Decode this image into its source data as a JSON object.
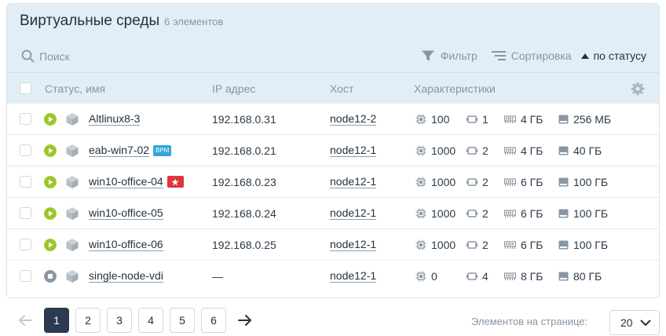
{
  "header": {
    "title": "Виртуальные среды",
    "count": "6 элементов"
  },
  "toolbar": {
    "search_placeholder": "Поиск",
    "filter_label": "Фильтр",
    "sort_label": "Сортировка",
    "sort_by": "по статусу"
  },
  "table": {
    "columns": {
      "status_name": "Статус, имя",
      "ip": "IP адрес",
      "host": "Хост",
      "specs": "Характеристики"
    },
    "rows": [
      {
        "name": "Altlinux8-3",
        "status": "running",
        "badge": "",
        "ip": "192.168.0.31",
        "host": "node12-2",
        "cpu": "100",
        "cores": "1",
        "ram": "4 ГБ",
        "disk": "256 МБ"
      },
      {
        "name": "eab-win7-02",
        "status": "running",
        "badge": "ВРМ",
        "ip": "192.168.0.21",
        "host": "node12-1",
        "cpu": "1000",
        "cores": "2",
        "ram": "4 ГБ",
        "disk": "40 ГБ"
      },
      {
        "name": "win10-office-04",
        "status": "running",
        "badge": "star",
        "ip": "192.168.0.23",
        "host": "node12-1",
        "cpu": "1000",
        "cores": "2",
        "ram": "6 ГБ",
        "disk": "100 ГБ"
      },
      {
        "name": "win10-office-05",
        "status": "running",
        "badge": "",
        "ip": "192.168.0.24",
        "host": "node12-1",
        "cpu": "1000",
        "cores": "2",
        "ram": "6 ГБ",
        "disk": "100 ГБ"
      },
      {
        "name": "win10-office-06",
        "status": "running",
        "badge": "",
        "ip": "192.168.0.25",
        "host": "node12-1",
        "cpu": "1000",
        "cores": "2",
        "ram": "6 ГБ",
        "disk": "100 ГБ"
      },
      {
        "name": "single-node-vdi",
        "status": "stopped",
        "badge": "",
        "ip": "—",
        "host": "node12-1",
        "cpu": "0",
        "cores": "4",
        "ram": "8 ГБ",
        "disk": "80 ГБ"
      }
    ]
  },
  "pagination": {
    "pages": [
      "1",
      "2",
      "3",
      "4",
      "5",
      "6"
    ],
    "current": "1",
    "per_page_label": "Элементов на странице:",
    "per_page_value": "20"
  },
  "colors": {
    "running": "#9bc72c",
    "stopped": "#8a97a3",
    "header_bg": "#e2eef6",
    "active_page": "#2c3a52",
    "badge_blue": "#2fa7d6",
    "badge_red": "#e0343c"
  },
  "icons": {
    "search": "search-icon",
    "filter": "filter-icon",
    "sort": "sort-icon",
    "sort_direction": "triangle-up-icon",
    "settings": "gear-icon",
    "vm": "cube-icon",
    "cpu": "cpu-icon",
    "cores": "cores-icon",
    "ram": "ram-icon",
    "disk": "disk-icon"
  }
}
